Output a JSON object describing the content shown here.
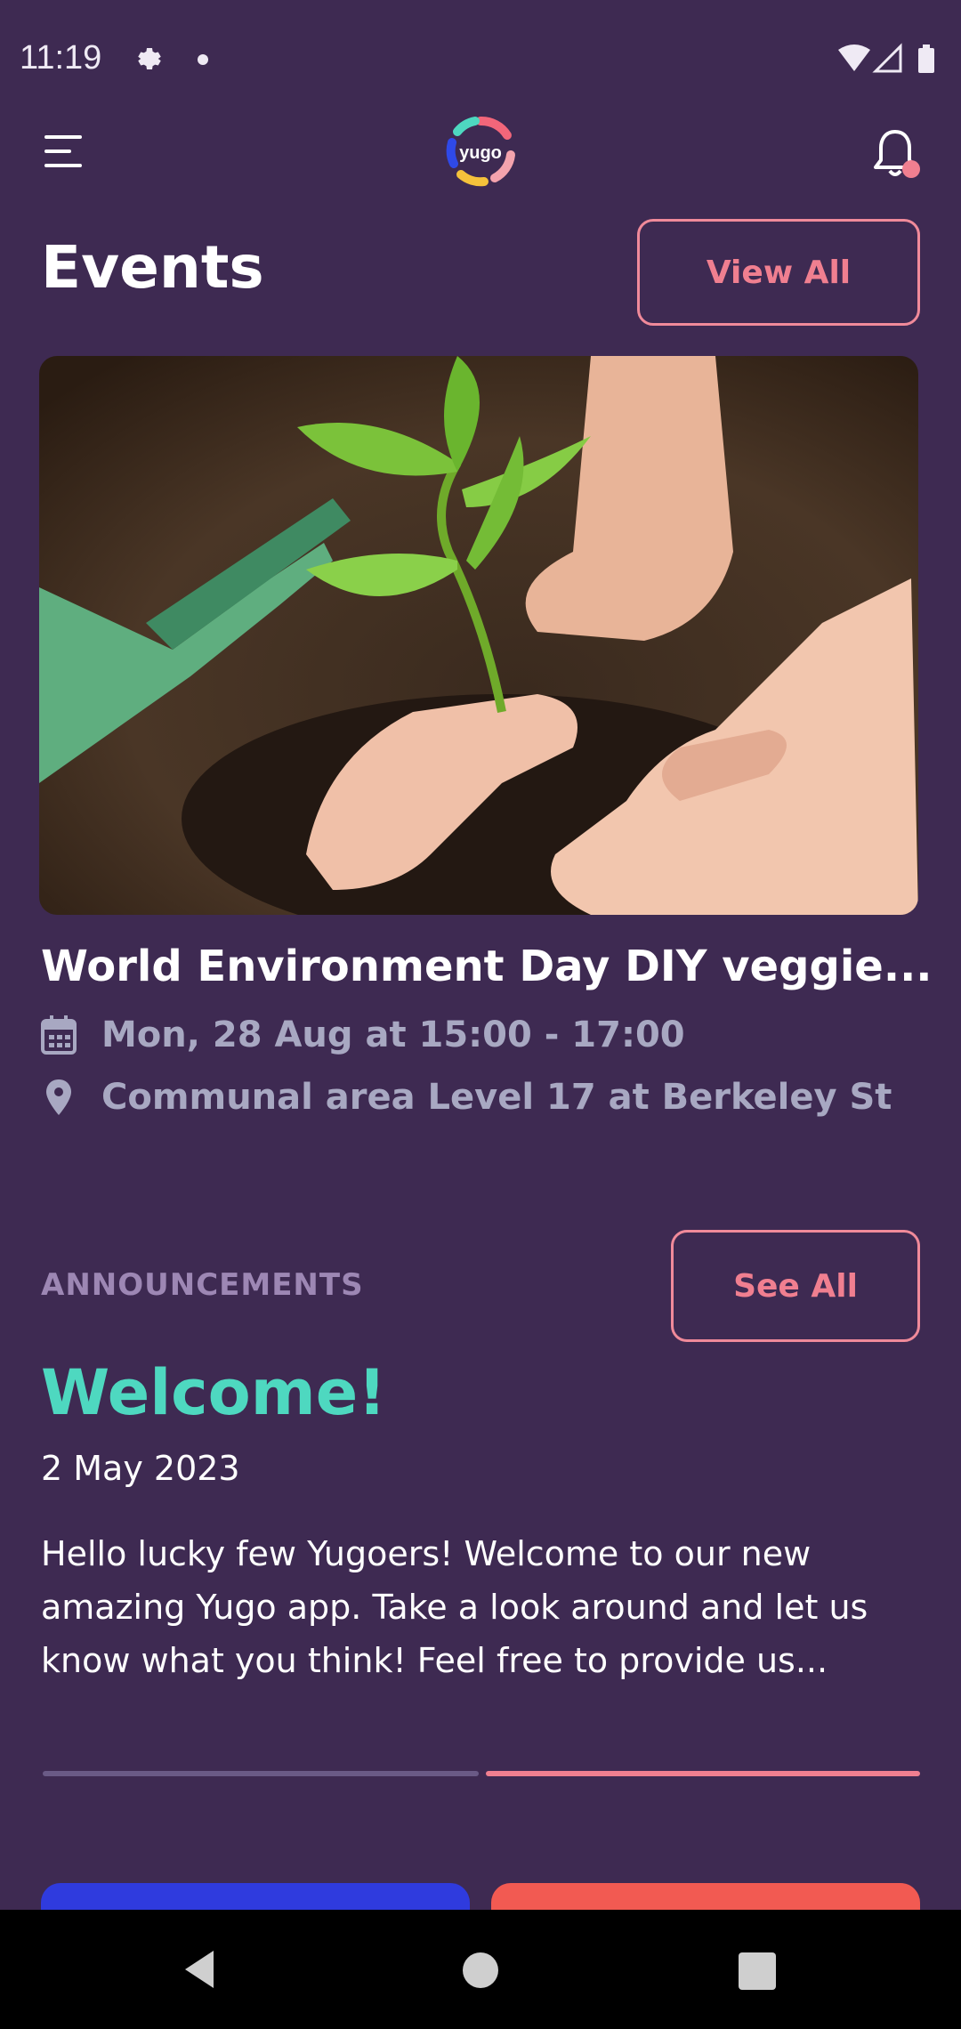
{
  "status_bar": {
    "time": "11:19"
  },
  "header": {
    "logo_text": "yugo"
  },
  "events": {
    "title": "Events",
    "view_all_label": "View All",
    "featured": {
      "title": "World Environment Day DIY veggie...",
      "datetime": "Mon, 28 Aug at 15:00 - 17:00",
      "location": "Communal area Level 17 at Berkeley St"
    }
  },
  "announcements": {
    "label": "ANNOUNCEMENTS",
    "see_all_label": "See All",
    "items": [
      {
        "title": "Welcome!",
        "date": "2 May 2023",
        "body": "Hello lucky few Yugoers! Welcome to our new amazing Yugo app. Take a look around and let us know what you think! Feel free to provide us..."
      }
    ],
    "pager": {
      "pages": 2,
      "active_page": 2
    }
  },
  "colors": {
    "background": "#3e2a52",
    "accent_pink": "#f07f90",
    "accent_teal": "#4ed8c0",
    "muted_text": "#a8a8c2",
    "card_blue": "#2f3bde",
    "card_red": "#f25a52"
  },
  "icons": [
    "gear-icon",
    "wifi-icon",
    "signal-icon",
    "battery-icon",
    "menu-icon",
    "bell-icon",
    "calendar-icon",
    "location-pin-icon",
    "back-icon",
    "home-icon",
    "recents-icon"
  ]
}
